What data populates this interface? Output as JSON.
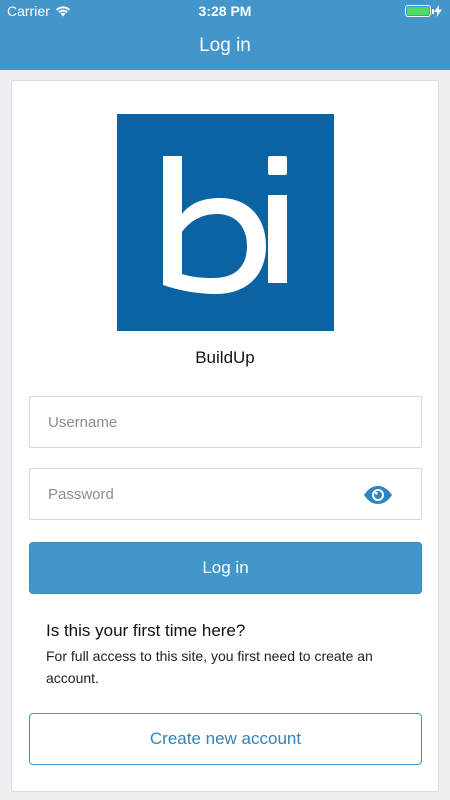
{
  "status_bar": {
    "carrier": "Carrier",
    "time": "3:28 PM",
    "battery_level": 1.0,
    "wifi_icon": "wifi-icon",
    "charging_icon": "bolt-icon"
  },
  "header": {
    "title": "Log in",
    "background_color": "#4296c9"
  },
  "site": {
    "logo_text": "bi",
    "logo_color": "#0b63a3",
    "name": "BuildUp"
  },
  "form": {
    "username_placeholder": "Username",
    "password_placeholder": "Password",
    "show_password_icon": "eye-icon",
    "login_label": "Log in"
  },
  "signup": {
    "heading": "Is this your first time here?",
    "text": "For full access to this site, you first need to create an account.",
    "button_label": "Create new account"
  }
}
